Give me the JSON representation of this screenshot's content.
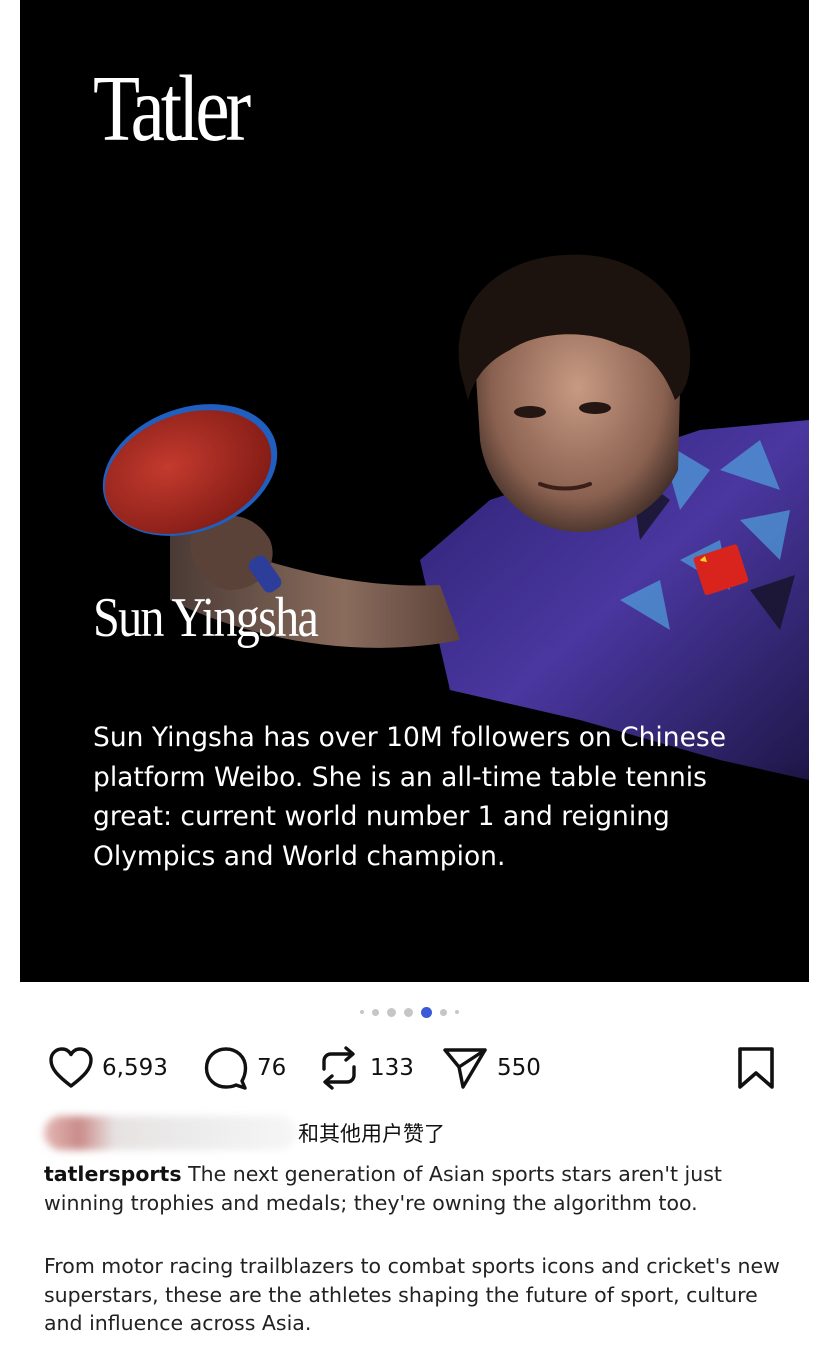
{
  "post": {
    "brand": "Tatler",
    "person_name": "Sun Yingsha",
    "bio": "Sun Yingsha has over 10M followers on Chinese platform Weibo. She is an all-time table tennis great: current world number 1 and reigning Olympics and World champion.",
    "slide_count": 7,
    "active_slide": 5
  },
  "actions": {
    "like": {
      "icon": "heart-icon",
      "count": "6,593"
    },
    "comment": {
      "icon": "speech-bubble-icon",
      "count": "76"
    },
    "repost": {
      "icon": "repost-icon",
      "count": "133"
    },
    "share": {
      "icon": "paper-plane-icon",
      "count": "550"
    },
    "save": {
      "icon": "bookmark-icon"
    }
  },
  "likes": {
    "text": "和其他用户赞了"
  },
  "caption": {
    "username": "tatlersports",
    "paragraph1": "The next generation of Asian sports stars aren't just winning trophies and medals; they're owning the algorithm too.",
    "paragraph2": "From motor racing trailblazers to combat sports icons and cricket's new superstars, these are the athletes shaping the future of sport, culture and influence across Asia."
  },
  "colors": {
    "accent": "#3a5ad8",
    "image_background": "#000000",
    "jersey": "#3d2f88"
  }
}
